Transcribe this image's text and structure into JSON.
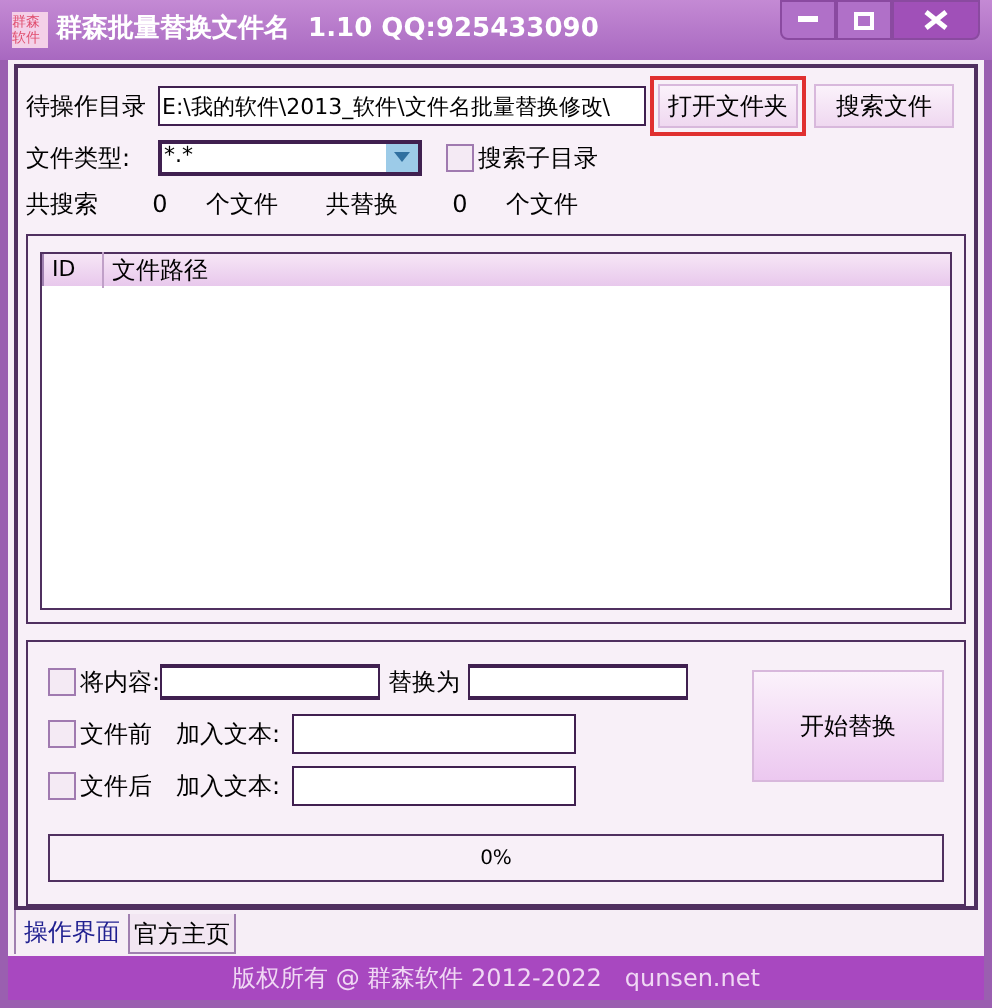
{
  "window": {
    "title": "群森批量替换文件名  1.10 QQ:925433090",
    "logo": "群森软件"
  },
  "directory": {
    "label": "待操作目录",
    "value": "E:\\我的软件\\2013_软件\\文件名批量替换修改\\"
  },
  "buttons": [
    {
      "label": "打开文件夹",
      "highlighted": true
    },
    {
      "label": "搜索文件",
      "highlighted": false
    }
  ],
  "file_type": {
    "label": "文件类型:",
    "value": "*.*"
  },
  "search_subdirs": {
    "label": "搜索子目录",
    "checked": false
  },
  "stats": [
    {
      "label": "共搜索",
      "value": "0",
      "unit": "个文件"
    },
    {
      "label": "共替换",
      "value": "0",
      "unit": "个文件"
    }
  ],
  "table": {
    "columns": [
      "ID",
      "文件路径"
    ]
  },
  "options": [
    {
      "label": "将内容:",
      "checked": false,
      "fields": [
        {
          "kind": "input"
        },
        {
          "kind": "input",
          "label": "替换为"
        }
      ]
    },
    {
      "label": "文件前",
      "checked": false,
      "fields": [
        {
          "kind": "input",
          "label": "加入文本:"
        }
      ]
    },
    {
      "label": "文件后",
      "checked": false,
      "fields": [
        {
          "kind": "input",
          "label": "加入文本:"
        }
      ]
    }
  ],
  "start_button": "开始替换",
  "progress": {
    "level": 0,
    "reading": "0%"
  },
  "tabs": [
    {
      "label": "操作界面",
      "selected": true
    },
    {
      "label": "官方主页",
      "selected": false
    }
  ],
  "status_bar": "版权所有 @ 群森软件 2012-2022   qunsen.net"
}
